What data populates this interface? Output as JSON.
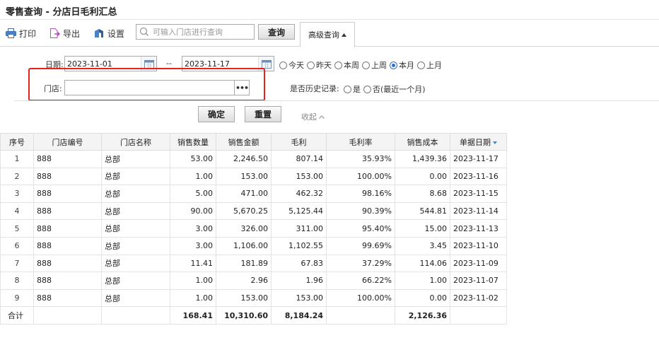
{
  "page": {
    "title": "零售查询 - 分店日毛利汇总"
  },
  "toolbar": {
    "print_label": "打印",
    "export_label": "导出",
    "settings_label": "设置",
    "search_placeholder": "可输入门店进行查询",
    "query_label": "查询",
    "advanced_label": "高级查询"
  },
  "filters": {
    "date_label": "日期:",
    "date_from": "2023-11-01",
    "date_separator": "--",
    "date_to": "2023-11-17",
    "range_options": [
      {
        "label": "今天",
        "selected": false
      },
      {
        "label": "昨天",
        "selected": false
      },
      {
        "label": "本周",
        "selected": false
      },
      {
        "label": "上周",
        "selected": false
      },
      {
        "label": "本月",
        "selected": true
      },
      {
        "label": "上月",
        "selected": false
      }
    ],
    "store_label": "门店:",
    "store_value": "",
    "history_label": "是否历史记录:",
    "history_options": [
      {
        "label": "是",
        "selected": false
      },
      {
        "label": "否(最近一个月)",
        "selected": false
      }
    ],
    "confirm_label": "确定",
    "reset_label": "重置",
    "collapse_label": "收起"
  },
  "table": {
    "columns": [
      "序号",
      "门店编号",
      "门店名称",
      "销售数量",
      "销售金额",
      "毛利",
      "毛利率",
      "销售成本",
      "单据日期"
    ],
    "rows": [
      [
        "1",
        "888",
        "总部",
        "53.00",
        "2,246.50",
        "807.14",
        "35.93%",
        "1,439.36",
        "2023-11-17"
      ],
      [
        "2",
        "888",
        "总部",
        "1.00",
        "153.00",
        "153.00",
        "100.00%",
        "0.00",
        "2023-11-16"
      ],
      [
        "3",
        "888",
        "总部",
        "5.00",
        "471.00",
        "462.32",
        "98.16%",
        "8.68",
        "2023-11-15"
      ],
      [
        "4",
        "888",
        "总部",
        "90.00",
        "5,670.25",
        "5,125.44",
        "90.39%",
        "544.81",
        "2023-11-14"
      ],
      [
        "5",
        "888",
        "总部",
        "3.00",
        "326.00",
        "311.00",
        "95.40%",
        "15.00",
        "2023-11-13"
      ],
      [
        "6",
        "888",
        "总部",
        "3.00",
        "1,106.00",
        "1,102.55",
        "99.69%",
        "3.45",
        "2023-11-10"
      ],
      [
        "7",
        "888",
        "总部",
        "11.41",
        "181.89",
        "67.83",
        "37.29%",
        "114.06",
        "2023-11-09"
      ],
      [
        "8",
        "888",
        "总部",
        "1.00",
        "2.96",
        "1.96",
        "66.22%",
        "1.00",
        "2023-11-07"
      ],
      [
        "9",
        "888",
        "总部",
        "1.00",
        "153.00",
        "153.00",
        "100.00%",
        "0.00",
        "2023-11-02"
      ]
    ],
    "total": [
      "合计",
      "",
      "",
      "168.41",
      "10,310.60",
      "8,184.24",
      "",
      "2,126.36",
      ""
    ]
  },
  "colors": {
    "accent": "#2a6fd6",
    "highlight": "#e8211c",
    "export_icon": "#b44ec6"
  }
}
